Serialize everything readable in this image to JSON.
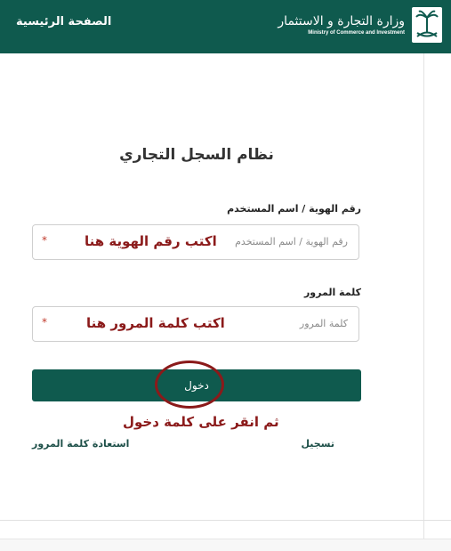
{
  "header": {
    "home_label": "الصفحة الرئيسية",
    "ministry_name_ar": "وزارة التجارة و الاستثمار",
    "ministry_name_en": "Ministry of Commerce and Investment",
    "background_color": "#0f5a4e"
  },
  "form": {
    "title": "نظام السجل التجاري",
    "username": {
      "label": "رقم الهوية / اسم المستخدم",
      "placeholder": "رقم الهوية / اسم المستخدم",
      "annotation": "اكتب رقم الهوية هنا",
      "required_mark": "*"
    },
    "password": {
      "label": "كلمة المرور",
      "placeholder": "كلمة المرور",
      "annotation": "اكتب كلمة المرور هنا",
      "required_mark": "*"
    },
    "login_label": "دخول",
    "instruction": "ثم انقر على كلمة دخول",
    "register_link": "تسجيل",
    "recover_link": "استعادة كلمة المرور"
  },
  "colors": {
    "primary": "#0f5a4e",
    "annotation": "#8b1a1a",
    "required": "#c0392b"
  }
}
